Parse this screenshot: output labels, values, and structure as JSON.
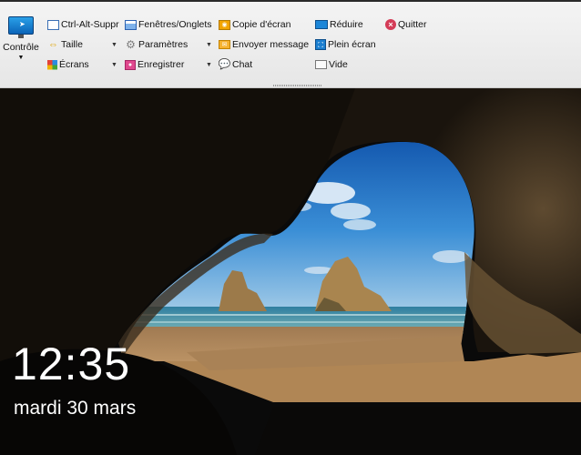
{
  "toolbar": {
    "control": {
      "label": "Contrôle",
      "icon": "monitor-icon"
    },
    "col1": [
      {
        "label": "Ctrl-Alt-Suppr",
        "icon": "ctrl-alt-del-icon"
      },
      {
        "label": "Taille",
        "icon": "resize-icon"
      },
      {
        "label": "Écrans",
        "icon": "screens-icon"
      }
    ],
    "col2": [
      {
        "label": "Fenêtres/Onglets",
        "icon": "windows-tabs-icon"
      },
      {
        "label": "Paramètres",
        "icon": "gear-icon"
      },
      {
        "label": "Enregistrer",
        "icon": "record-icon"
      }
    ],
    "col3": [
      {
        "label": "Copie d'écran",
        "icon": "screenshot-icon"
      },
      {
        "label": "Envoyer message",
        "icon": "mail-icon"
      },
      {
        "label": "Chat",
        "icon": "chat-icon"
      }
    ],
    "col4": [
      {
        "label": "Réduire",
        "icon": "minimize-icon"
      },
      {
        "label": "Plein écran",
        "icon": "fullscreen-icon"
      },
      {
        "label": "Vide",
        "icon": "blank-icon"
      }
    ],
    "quit": {
      "label": "Quitter",
      "icon": "close-circle-icon"
    }
  },
  "lockscreen": {
    "time": "12:35",
    "date": "mardi 30 mars"
  },
  "colors": {
    "accent": "#0b64b8",
    "quit": "#d43c57"
  }
}
